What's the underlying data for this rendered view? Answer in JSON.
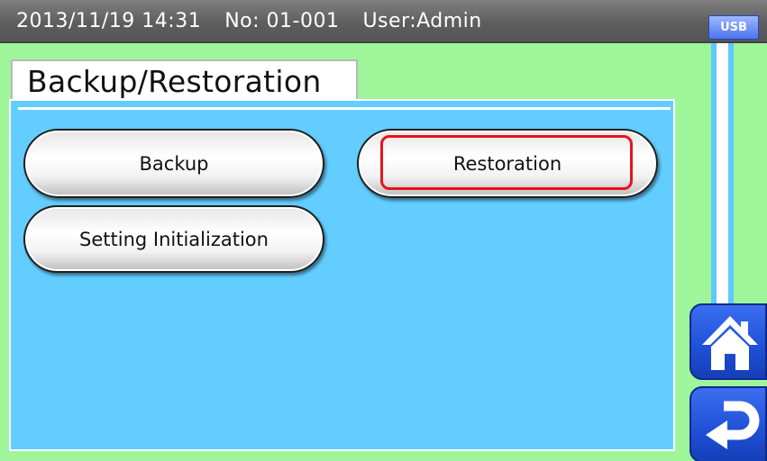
{
  "status_bar": {
    "datetime": "2013/11/19 14:31",
    "number": "No: 01-001",
    "user": "User:Admin",
    "usb_label": "USB"
  },
  "page": {
    "title": "Backup/Restoration"
  },
  "buttons": {
    "backup": "Backup",
    "restoration": "Restoration",
    "setting_initialization": "Setting Initialization"
  },
  "icons": {
    "home": "home-icon",
    "back": "return-arrow-icon"
  },
  "colors": {
    "background": "#9ff59a",
    "panel": "#63cdff",
    "nav_button": "#1e4fd6",
    "highlight": "#e8131d"
  }
}
